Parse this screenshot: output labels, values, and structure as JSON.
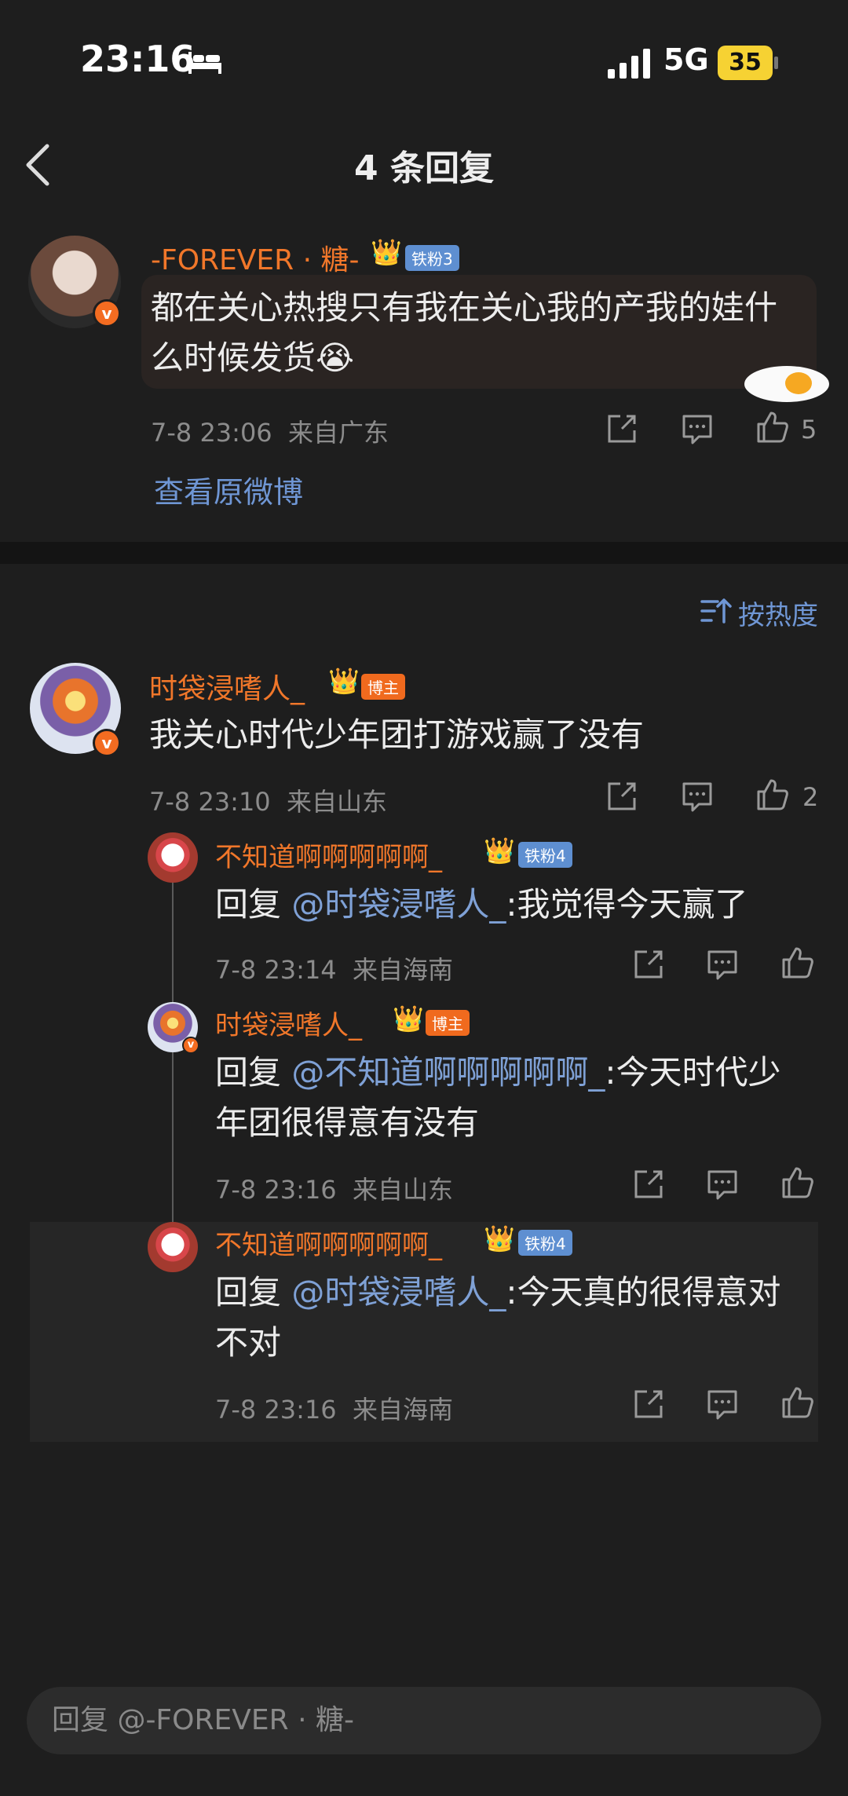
{
  "status": {
    "time": "23:16",
    "network": "5G",
    "battery": "35"
  },
  "header": {
    "title": "4 条回复"
  },
  "original": {
    "name": "-FOREVER · 糖-",
    "badge": "铁粉3",
    "text": "都在关心热搜只有我在关心我的产我的娃什么时候发货",
    "emoji": "😭",
    "time": "7-8 23:06",
    "location": "来自广东",
    "likes": "5",
    "view_original": "查看原微博"
  },
  "sort": {
    "label": "按热度"
  },
  "replies": [
    {
      "name": "时袋浸嗜人_",
      "badge": "博主",
      "text": "我关心时代少年团打游戏赢了没有",
      "time": "7-8 23:10",
      "location": "来自山东",
      "likes": "2"
    },
    {
      "name": "不知道啊啊啊啊啊_",
      "badge": "铁粉4",
      "reply_prefix": "回复",
      "mention": "@时袋浸嗜人_",
      "text": ":我觉得今天赢了",
      "time": "7-8 23:14",
      "location": "来自海南"
    },
    {
      "name": "时袋浸嗜人_",
      "badge": "博主",
      "reply_prefix": "回复",
      "mention": "@不知道啊啊啊啊啊_",
      "text": ":今天时代少年团很得意有没有",
      "time": "7-8 23:16",
      "location": "来自山东"
    },
    {
      "name": "不知道啊啊啊啊啊_",
      "badge": "铁粉4",
      "reply_prefix": "回复",
      "mention": "@时袋浸嗜人_",
      "text": ":今天真的很得意对不对",
      "time": "7-8 23:16",
      "location": "来自海南"
    }
  ],
  "input": {
    "placeholder": "回复 @-FOREVER · 糖-"
  },
  "colors": {
    "accent": "#f1772a",
    "link": "#6f96d4",
    "background": "#1e1e1e"
  }
}
